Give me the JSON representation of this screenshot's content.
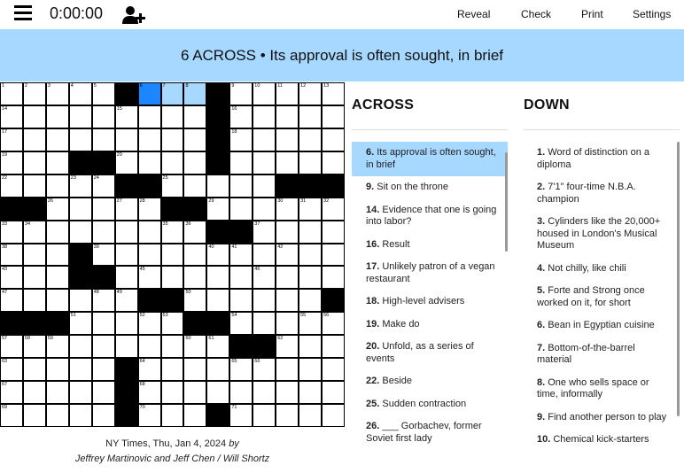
{
  "toolbar": {
    "timer": "0:00:00",
    "reveal": "Reveal",
    "check": "Check",
    "print": "Print",
    "settings": "Settings"
  },
  "banner": {
    "clue": "6 ACROSS • Its approval is often sought, in brief"
  },
  "grid": {
    "size": 15,
    "rows": [
      "....#...#......",
      "....#.......#..",
      "....#..........",
      "...##...#......",
      "....##...#...##",
      "...#..##..##...",
      "..............#",
      "...#....##...#.",
      "..##.....#..#..",
      "...#....##.....",
      "##..##...#...##",
      "......##...###.",
      ".....#.........",
      ".....#.........",
      ".....#...#....."
    ],
    "blacks": [
      [
        0,
        5
      ],
      [
        1,
        9
      ],
      [
        2,
        9
      ],
      [
        3,
        3
      ],
      [
        3,
        4
      ],
      [
        4,
        5
      ],
      [
        4,
        6
      ],
      [
        4,
        12
      ],
      [
        4,
        13
      ],
      [
        4,
        14
      ],
      [
        5,
        0
      ],
      [
        5,
        1
      ],
      [
        5,
        7
      ],
      [
        5,
        8
      ],
      [
        6,
        9
      ],
      [
        6,
        10
      ],
      [
        7,
        3
      ],
      [
        8,
        3
      ],
      [
        8,
        4
      ],
      [
        9,
        6
      ],
      [
        9,
        7
      ],
      [
        9,
        14
      ],
      [
        10,
        0
      ],
      [
        10,
        1
      ],
      [
        10,
        2
      ],
      [
        10,
        8
      ],
      [
        10,
        9
      ],
      [
        11,
        10
      ],
      [
        11,
        11
      ],
      [
        12,
        5
      ],
      [
        13,
        5
      ],
      [
        14,
        5
      ],
      [
        14,
        9
      ],
      [
        0,
        9
      ],
      [
        3,
        9
      ]
    ],
    "active": [
      0,
      6
    ],
    "word": [
      [
        0,
        7
      ],
      [
        0,
        8
      ]
    ],
    "numbers": [
      [
        0,
        0,
        "1"
      ],
      [
        0,
        1,
        "2"
      ],
      [
        0,
        2,
        "3"
      ],
      [
        0,
        3,
        "4"
      ],
      [
        0,
        4,
        "5"
      ],
      [
        0,
        6,
        "6"
      ],
      [
        0,
        7,
        "7"
      ],
      [
        0,
        8,
        "8"
      ],
      [
        0,
        10,
        "9"
      ],
      [
        0,
        11,
        "10"
      ],
      [
        0,
        12,
        "11"
      ],
      [
        0,
        13,
        "12"
      ],
      [
        0,
        14,
        "13"
      ],
      [
        1,
        0,
        "14"
      ],
      [
        1,
        5,
        "15"
      ],
      [
        1,
        10,
        "16"
      ],
      [
        2,
        0,
        "17"
      ],
      [
        2,
        10,
        "18"
      ],
      [
        3,
        0,
        "19"
      ],
      [
        3,
        5,
        "20"
      ],
      [
        3,
        9,
        "21"
      ],
      [
        4,
        0,
        "22"
      ],
      [
        4,
        3,
        "23"
      ],
      [
        4,
        4,
        "24"
      ],
      [
        4,
        7,
        "25"
      ],
      [
        5,
        2,
        "26"
      ],
      [
        5,
        5,
        "27"
      ],
      [
        5,
        6,
        "28"
      ],
      [
        5,
        9,
        "29"
      ],
      [
        5,
        12,
        "30"
      ],
      [
        5,
        13,
        "31"
      ],
      [
        5,
        14,
        "32"
      ],
      [
        6,
        0,
        "33"
      ],
      [
        6,
        1,
        "34"
      ],
      [
        6,
        7,
        "35"
      ],
      [
        6,
        8,
        "36"
      ],
      [
        6,
        11,
        "37"
      ],
      [
        7,
        0,
        "38"
      ],
      [
        7,
        4,
        "39"
      ],
      [
        7,
        9,
        "40"
      ],
      [
        7,
        10,
        "41"
      ],
      [
        7,
        12,
        "42"
      ],
      [
        8,
        0,
        "43"
      ],
      [
        8,
        3,
        "44"
      ],
      [
        8,
        6,
        "45"
      ],
      [
        8,
        11,
        "46"
      ],
      [
        9,
        0,
        "47"
      ],
      [
        9,
        4,
        "48"
      ],
      [
        9,
        5,
        "49"
      ],
      [
        9,
        8,
        "50"
      ],
      [
        10,
        3,
        "51"
      ],
      [
        10,
        6,
        "52"
      ],
      [
        10,
        7,
        "53"
      ],
      [
        10,
        10,
        "54"
      ],
      [
        10,
        13,
        "55"
      ],
      [
        10,
        14,
        "56"
      ],
      [
        11,
        0,
        "57"
      ],
      [
        11,
        1,
        "58"
      ],
      [
        11,
        2,
        "59"
      ],
      [
        11,
        8,
        "60"
      ],
      [
        11,
        9,
        "61"
      ],
      [
        11,
        12,
        "62"
      ],
      [
        12,
        0,
        "63"
      ],
      [
        12,
        6,
        "64"
      ],
      [
        12,
        10,
        "65"
      ],
      [
        12,
        11,
        "66"
      ],
      [
        13,
        0,
        "67"
      ],
      [
        13,
        6,
        "68"
      ],
      [
        14,
        0,
        "69"
      ],
      [
        14,
        6,
        "70"
      ],
      [
        14,
        10,
        "71"
      ]
    ]
  },
  "byline": {
    "line1_prefix": "NY Times, Thu, Jan 4, 2024 ",
    "line1_by": "by",
    "line2": "Jeffrey Martinovic and Jeff Chen / Will Shortz"
  },
  "across": {
    "title": "ACROSS",
    "clues": [
      {
        "num": "6.",
        "text": "Its approval is often sought, in brief",
        "active": true
      },
      {
        "num": "9.",
        "text": "Sit on the throne"
      },
      {
        "num": "14.",
        "text": "Evidence that one is going into labor?"
      },
      {
        "num": "16.",
        "text": "Result"
      },
      {
        "num": "17.",
        "text": "Unlikely patron of a vegan restaurant"
      },
      {
        "num": "18.",
        "text": "High-level advisers"
      },
      {
        "num": "19.",
        "text": "Make do"
      },
      {
        "num": "20.",
        "text": "Unfold, as a series of events"
      },
      {
        "num": "22.",
        "text": "Beside"
      },
      {
        "num": "25.",
        "text": "Sudden contraction"
      },
      {
        "num": "26.",
        "text": "___ Gorbachev, former Soviet first lady"
      }
    ]
  },
  "down": {
    "title": "DOWN",
    "clues": [
      {
        "num": "1.",
        "text": "Word of distinction on a diploma"
      },
      {
        "num": "2.",
        "text": "7'1\" four-time N.B.A. champion"
      },
      {
        "num": "3.",
        "text": "Cylinders like the 20,000+ housed in London's Musical Museum"
      },
      {
        "num": "4.",
        "text": "Not chilly, like chili"
      },
      {
        "num": "5.",
        "text": "Forte and Strong once worked on it, for short"
      },
      {
        "num": "6.",
        "text": "Bean in Egyptian cuisine"
      },
      {
        "num": "7.",
        "text": "Bottom-of-the-barrel material"
      },
      {
        "num": "8.",
        "text": "One who sells space or time, informally"
      },
      {
        "num": "9.",
        "text": "Find another person to play"
      },
      {
        "num": "10.",
        "text": "Chemical kick-starters"
      }
    ]
  },
  "colors": {
    "banner": "#a7d8ff",
    "active_cell": "#1b86ff",
    "word_cell": "#a7d8ff"
  }
}
